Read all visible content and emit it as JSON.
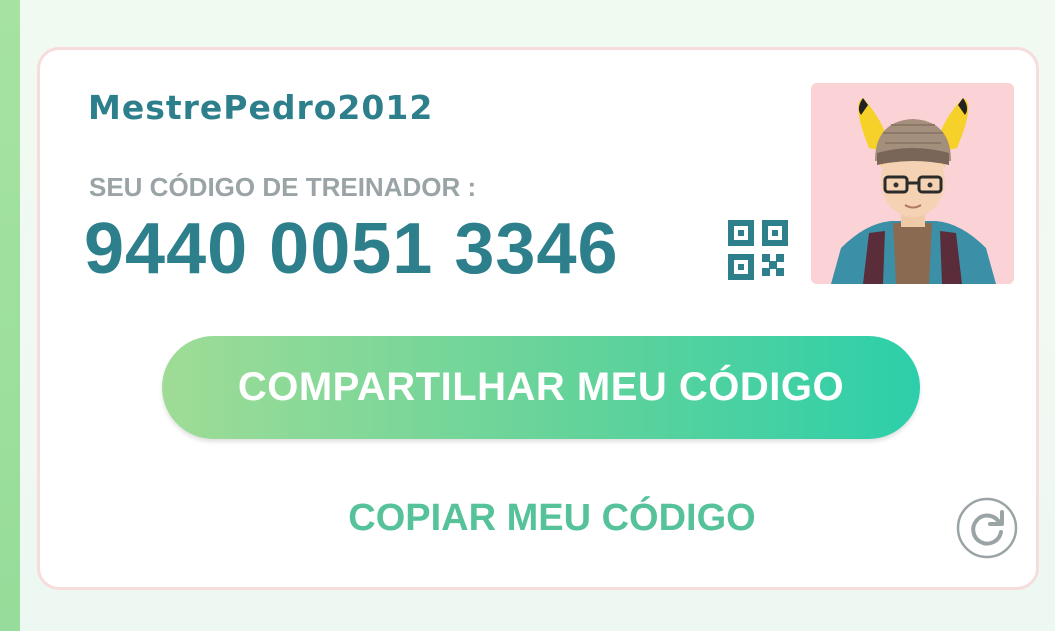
{
  "profile": {
    "username": "MestrePedro2012",
    "code_label": "SEU CÓDIGO DE TREINADOR :",
    "trainer_code": "9440 0051 3346"
  },
  "actions": {
    "share_label": "COMPARTILHAR MEU CÓDIGO",
    "copy_label": "COPIAR MEU CÓDIGO"
  },
  "icons": {
    "qr": "qr-code-icon",
    "refresh": "refresh-icon",
    "avatar": "trainer-avatar"
  },
  "colors": {
    "primary_text": "#2e7f8c",
    "label_text": "#9aa3a6",
    "share_gradient_start": "#9fdc96",
    "share_gradient_end": "#2ccfaa",
    "copy_text": "#55c29a",
    "avatar_bg": "#fbd3d6"
  }
}
